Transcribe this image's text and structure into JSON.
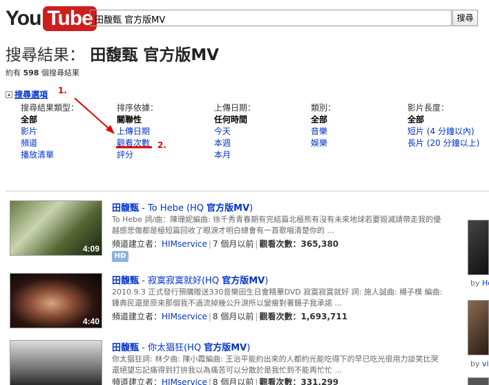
{
  "header": {
    "logo_you": "You",
    "logo_tube": "Tube",
    "search_value": "田馥甄 官方版MV",
    "search_button": "搜尋"
  },
  "page": {
    "title_prefix": "搜尋結果：",
    "title_query": "田馥甄 官方版MV",
    "count_prefix": "約有",
    "count_value": "598",
    "count_suffix": "個搜尋結果"
  },
  "options": {
    "toggle_label": "搜尋選項",
    "columns": [
      {
        "header": "搜尋結果類型：",
        "selected": "全部",
        "items": [
          "影片",
          "頻道",
          "播放清單"
        ]
      },
      {
        "header": "排序依據：",
        "selected": "關聯性",
        "items": [
          "上傳日期",
          "觀看次數",
          "評分"
        ]
      },
      {
        "header": "上傳日期：",
        "selected": "任何時間",
        "items": [
          "今天",
          "本週",
          "本月"
        ]
      },
      {
        "header": "類別：",
        "selected": "全部",
        "items": [
          "音樂",
          "娛樂"
        ]
      },
      {
        "header": "影片長度：",
        "selected": "全部",
        "items": [
          "短片 (4 分鐘以內)",
          "長片 (20 分鐘以上)"
        ]
      }
    ]
  },
  "annotations": {
    "step1": "1.",
    "step2": "2."
  },
  "results": [
    {
      "title_artist": "田馥甄",
      "title_rest": " - To Hebe (HQ ",
      "title_tag": "官方版MV",
      "title_end": ")",
      "desc": "To Hebe 詞/曲：陳珊妮編曲: 徐千秀青春期有完結篇北極熊有沒有未來地球若要毀滅請帶走我的優越感悲傷都是極短篇回收了眼淚才明白總會有一首歌唱清楚你的 ...",
      "uploader_label": "頻道建立者：",
      "uploader": "HIMservice",
      "age": "7 個月以前",
      "views_label": "觀看次數：",
      "views": "365,380",
      "duration": "4:09",
      "badge": "HD"
    },
    {
      "title_artist": "田馥甄",
      "title_rest": " - 寂寞寂寞就好(HQ ",
      "title_tag": "官方版MV",
      "title_end": ")",
      "desc": "2010.9.3 正式發行預購贈送330音樂田生日會精華DVD 寂寞寂寞就好 詞: 施人誠曲: 楊子樸 編曲: 鍾典民還是原來那個我不過流掉幾公升淚所以變瘦對著鏡子我承諾 ...",
      "uploader_label": "頻道建立者：",
      "uploader": "HIMservice",
      "age": "8 個月以前",
      "views_label": "觀看次數：",
      "views": "1,693,711",
      "duration": "4:40"
    },
    {
      "title_artist": "田馥甄",
      "title_rest": " - 你太猖狂(HQ ",
      "title_tag": "官方版MV",
      "title_end": ")",
      "desc": "你太猖狂詞: 林夕曲: 陳小霞編曲: 王治平能約出來的人都約光能吃得下的早已吃光很用力談笑比哭還絕望忘記痛得到打拚我以為痛苦可以分散於是我忙到不能再忙忙 ...",
      "uploader_label": "頻道建立者：",
      "uploader": "HIMservice",
      "age": "8 個月以前",
      "views_label": "觀看次數：",
      "views": "331,299",
      "duration": ""
    }
  ],
  "sidebar": {
    "by1_prefix": "by ",
    "by1_user": "Ho",
    "by2_prefix": "by ",
    "by2_user": "viz"
  }
}
